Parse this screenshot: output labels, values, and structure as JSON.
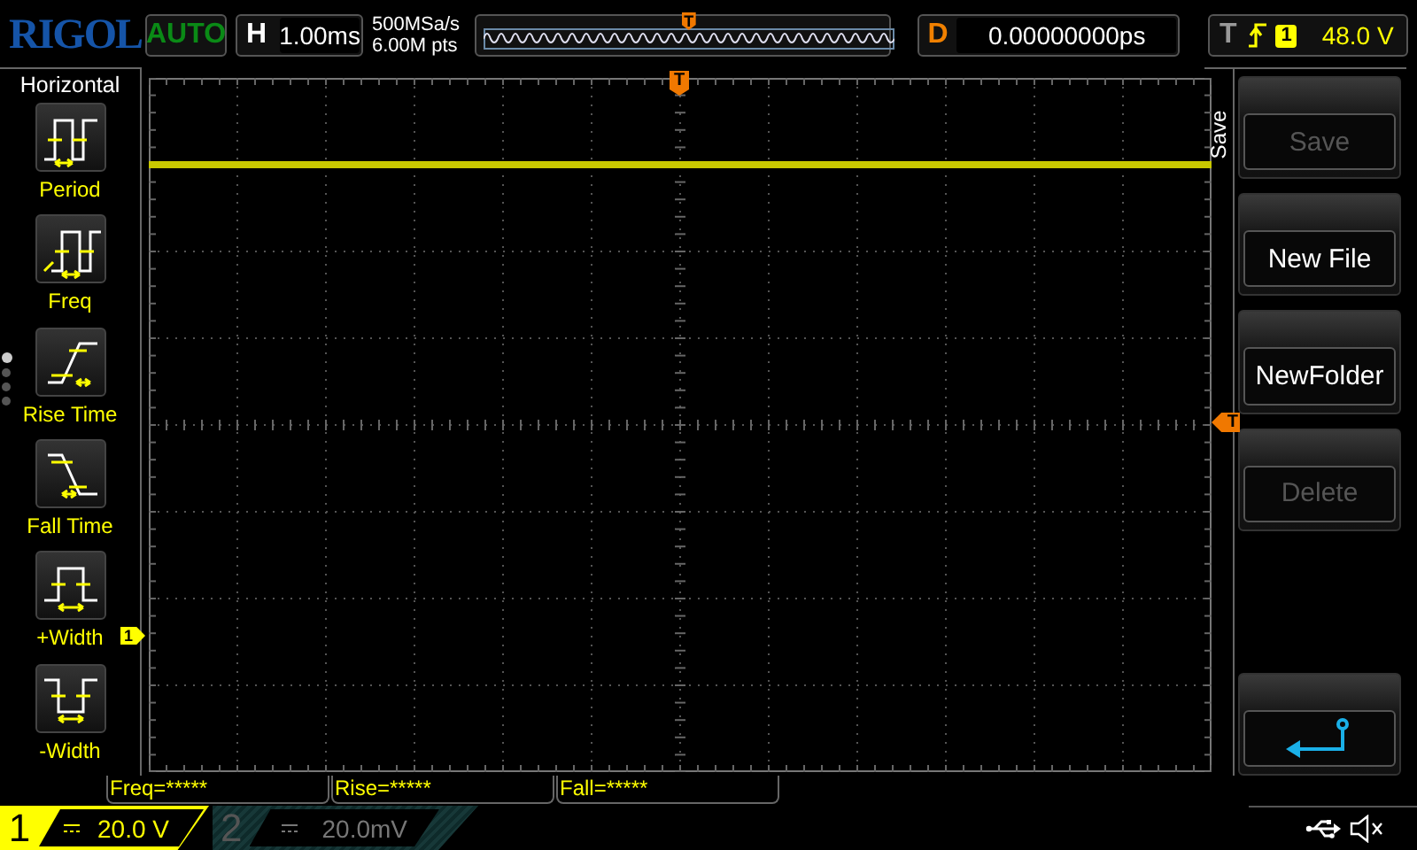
{
  "logo": "RIGOL",
  "run_status": "AUTO",
  "timebase": {
    "label": "H",
    "value": "1.00ms"
  },
  "acquisition": {
    "rate": "500MSa/s",
    "depth": "6.00M pts"
  },
  "overview": {
    "trigger_marker": "T"
  },
  "delay": {
    "label": "D",
    "value": "0.00000000ps"
  },
  "trigger": {
    "label": "T",
    "source": "1",
    "level": "48.0 V"
  },
  "measure_menu": {
    "title": "Horizontal",
    "items": [
      {
        "kind": "period",
        "label": "Period"
      },
      {
        "kind": "freq",
        "label": "Freq"
      },
      {
        "kind": "rise",
        "label": "Rise Time"
      },
      {
        "kind": "fall",
        "label": "Fall Time"
      },
      {
        "kind": "pwidth",
        "label": "+Width"
      },
      {
        "kind": "nwidth",
        "label": "-Width"
      }
    ],
    "pages": [
      {
        "selected": true
      },
      {
        "selected": false
      },
      {
        "selected": false
      },
      {
        "selected": false
      }
    ]
  },
  "screen": {
    "top_trigger_marker": "T",
    "right_trigger_marker": "T",
    "channel_marker": "1"
  },
  "soft_menu": {
    "title": "Save",
    "buttons": [
      {
        "kind": "text",
        "label": "Save",
        "disabled": true
      },
      {
        "kind": "text",
        "label": "New File",
        "disabled": false
      },
      {
        "kind": "text",
        "label": "NewFolder",
        "disabled": false
      },
      {
        "kind": "text",
        "label": "Delete",
        "disabled": true
      },
      {
        "kind": "back"
      }
    ]
  },
  "measurements": [
    "Freq=*****",
    "Rise=*****",
    "Fall=*****"
  ],
  "channels": [
    {
      "number": "1",
      "scale": "20.0 V",
      "active": true
    },
    {
      "number": "2",
      "scale": "20.0mV",
      "active": false
    }
  ]
}
